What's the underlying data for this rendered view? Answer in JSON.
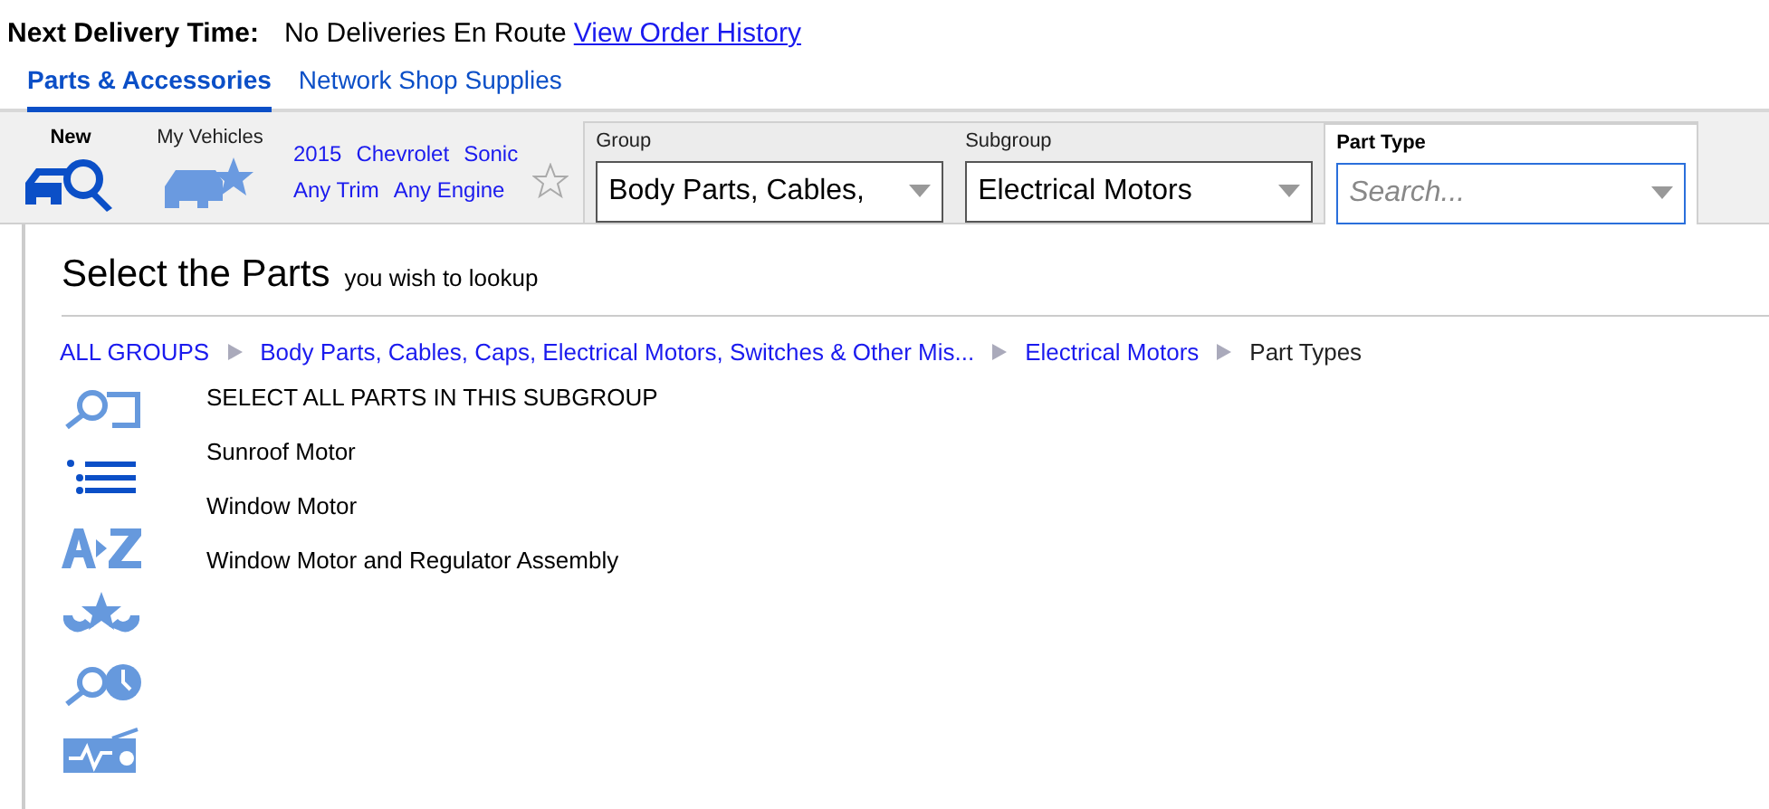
{
  "delivery": {
    "label": "Next Delivery Time:",
    "value": "No Deliveries En Route",
    "link": "View Order History"
  },
  "tabs": [
    {
      "label": "Parts & Accessories",
      "selected": true
    },
    {
      "label": "Network Shop Supplies",
      "selected": false
    }
  ],
  "toolbar": {
    "new_label": "New",
    "vehicles_label": "My Vehicles",
    "vehicle": [
      "2015",
      "Chevrolet",
      "Sonic"
    ],
    "vehicle_options": [
      "Any Trim",
      "Any Engine"
    ],
    "favorite": false
  },
  "selectors": [
    {
      "label": "Group",
      "value": "Body Parts, Cables,",
      "active": false
    },
    {
      "label": "Subgroup",
      "value": "Electrical Motors",
      "active": false
    },
    {
      "label": "Part Type",
      "placeholder": "Search...",
      "active": true
    }
  ],
  "heading": {
    "title": "Select the Parts",
    "subtitle": "you wish to lookup"
  },
  "breadcrumb": [
    {
      "label": "ALL GROUPS",
      "link": true
    },
    {
      "label": "Body Parts, Cables, Caps, Electrical Motors, Switches & Other Mis...",
      "link": true
    },
    {
      "label": "Electrical Motors",
      "link": true
    },
    {
      "label": "Part Types",
      "link": false
    }
  ],
  "view_modes": [
    {
      "kind": "search",
      "selected": false
    },
    {
      "kind": "list",
      "selected": true
    },
    {
      "kind": "az",
      "selected": false
    },
    {
      "kind": "favorites",
      "selected": false
    },
    {
      "kind": "history",
      "selected": false
    },
    {
      "kind": "diagnostic",
      "selected": false
    }
  ],
  "parts": [
    "SELECT ALL PARTS IN THIS SUBGROUP",
    "Sunroof Motor",
    "Window Motor",
    "Window Motor and Regulator Assembly"
  ]
}
